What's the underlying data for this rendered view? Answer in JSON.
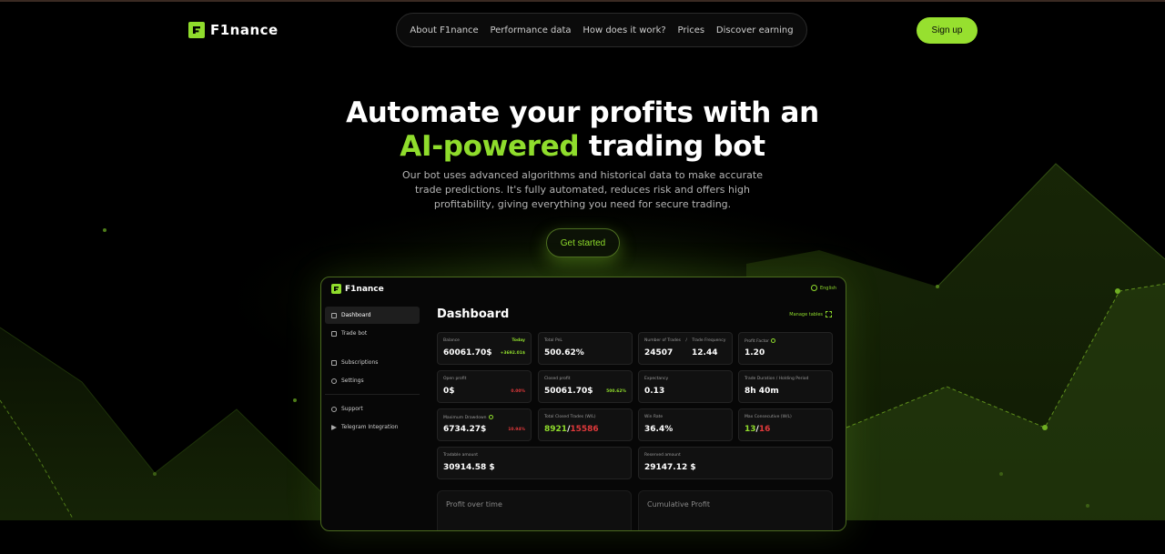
{
  "brand": {
    "name": "F1nance"
  },
  "nav": {
    "items": [
      "About F1nance",
      "Performance data",
      "How does it work?",
      "Prices",
      "Discover earning"
    ],
    "signup": "Sign up"
  },
  "hero": {
    "title_line1": "Automate your profits with an",
    "title_accent": "AI-powered",
    "title_rest": "trading bot",
    "subtitle": "Our bot uses advanced algorithms and historical data to make accurate trade predictions. It's fully automated, reduces risk and offers high profitability, giving everything you need for secure trading.",
    "cta": "Get started"
  },
  "dashboard": {
    "brand": "F1nance",
    "language": "English",
    "title": "Dashboard",
    "manage_tables": "Manage tables",
    "sidebar": {
      "items": [
        "Dashboard",
        "Trade bot",
        "Subscriptions",
        "Settings",
        "Support",
        "Telegram Integration"
      ]
    },
    "cards": {
      "balance": {
        "label": "Balance",
        "value": "60061.70$",
        "tag_label": "Today",
        "tag": "+3692.01$"
      },
      "total_pnl": {
        "label": "Total PnL",
        "value": "500.62%"
      },
      "num_trades": {
        "label": "Number of Trades",
        "sep": "/",
        "label2": "Trade Frequency",
        "value": "24507",
        "value2": "12.44"
      },
      "profit_factor": {
        "label": "Profit Factor",
        "value": "1.20"
      },
      "open_profit": {
        "label": "Open profit",
        "value": "0$",
        "tag": "0.00%"
      },
      "closed_profit": {
        "label": "Closed profit",
        "value": "50061.70$",
        "tag": "500.62%"
      },
      "expectancy": {
        "label": "Expectancy",
        "value": "0.13"
      },
      "trade_duration": {
        "label": "Trade Duration / Holding Period",
        "value": "8h 40m"
      },
      "max_drawdown": {
        "label": "Maximum Drawdown",
        "value": "6734.27$",
        "tag": "10.94%"
      },
      "total_closed": {
        "label": "Total Closed Trades (W/L)",
        "win": "8921",
        "sep": "/",
        "loss": "15586"
      },
      "win_rate": {
        "label": "Win Rate",
        "value": "36.4%"
      },
      "max_consecutive": {
        "label": "Max Consecutive (W/L)",
        "win": "13",
        "sep": "/",
        "loss": "16"
      },
      "tradable": {
        "label": "Tradable amount",
        "value": "30914.58 $"
      },
      "reserved": {
        "label": "Reserved amount",
        "value": "29147.12 $"
      }
    },
    "charts": {
      "profit_over_time": "Profit over time",
      "cumulative_profit": "Cumulative Profit"
    }
  },
  "colors": {
    "accent": "#8fdc2c",
    "loss": "#e0393b",
    "background": "#000000"
  }
}
